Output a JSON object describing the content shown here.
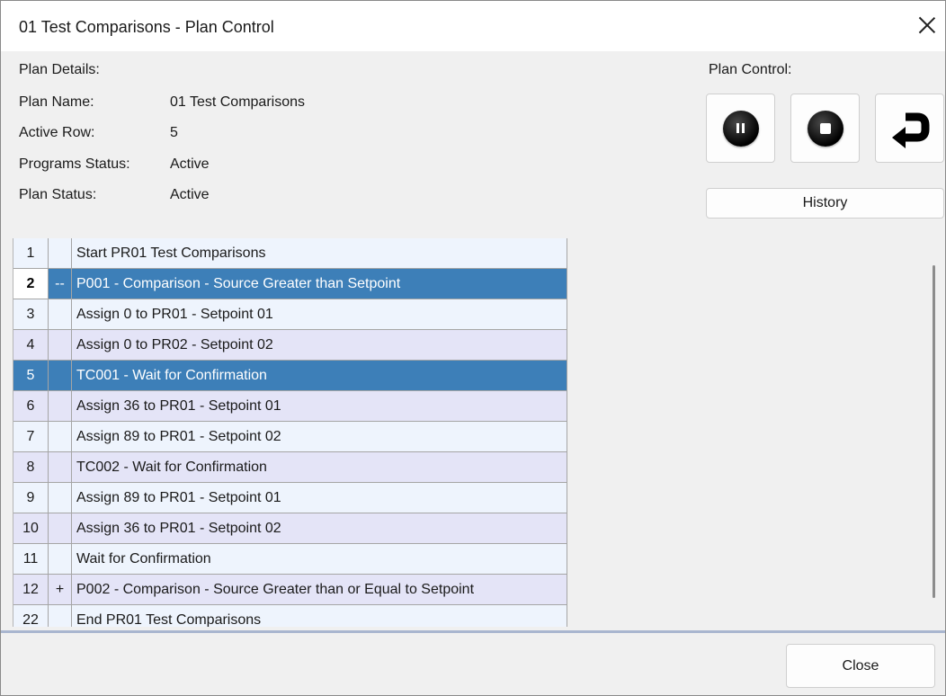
{
  "window": {
    "title": "01 Test Comparisons - Plan Control"
  },
  "details": {
    "heading": "Plan Details:",
    "plan_name_label": "Plan Name:",
    "plan_name_value": "01 Test Comparisons",
    "active_row_label": "Active Row:",
    "active_row_value": "5",
    "programs_status_label": "Programs Status:",
    "programs_status_value": "Active",
    "plan_status_label": "Plan Status:",
    "plan_status_value": "Active"
  },
  "plan_control": {
    "heading": "Plan Control:",
    "buttons": [
      "pause-icon",
      "stop-icon",
      "return-arrow-icon"
    ],
    "history_label": "History"
  },
  "rows": [
    {
      "num": "1",
      "toggle": "",
      "text": "Start PR01 Test Comparisons"
    },
    {
      "num": "2",
      "toggle": "--",
      "text": "P001 - Comparison - Source Greater than Setpoint"
    },
    {
      "num": "3",
      "toggle": "",
      "text": "Assign 0 to PR01 - Setpoint 01"
    },
    {
      "num": "4",
      "toggle": "",
      "text": "Assign 0 to PR02 - Setpoint 02"
    },
    {
      "num": "5",
      "toggle": "",
      "text": "TC001 - Wait for Confirmation"
    },
    {
      "num": "6",
      "toggle": "",
      "text": "Assign 36 to PR01 - Setpoint 01"
    },
    {
      "num": "7",
      "toggle": "",
      "text": "Assign 89 to PR01 - Setpoint 02"
    },
    {
      "num": "8",
      "toggle": "",
      "text": "TC002 - Wait for Confirmation"
    },
    {
      "num": "9",
      "toggle": "",
      "text": "Assign 89 to PR01 - Setpoint 01"
    },
    {
      "num": "10",
      "toggle": "",
      "text": "Assign 36 to PR01 - Setpoint 02"
    },
    {
      "num": "11",
      "toggle": "",
      "text": "Wait for Confirmation"
    },
    {
      "num": "12",
      "toggle": "+",
      "text": "P002 - Comparison - Source Greater than or Equal to Setpoint"
    },
    {
      "num": "22",
      "toggle": "",
      "text": "End PR01 Test Comparisons"
    }
  ],
  "footer": {
    "close_label": "Close"
  },
  "colors": {
    "selected_row": "#3d7fb8",
    "row_alt_a": "#eef4fd",
    "row_alt_b": "#e4e4f7"
  }
}
